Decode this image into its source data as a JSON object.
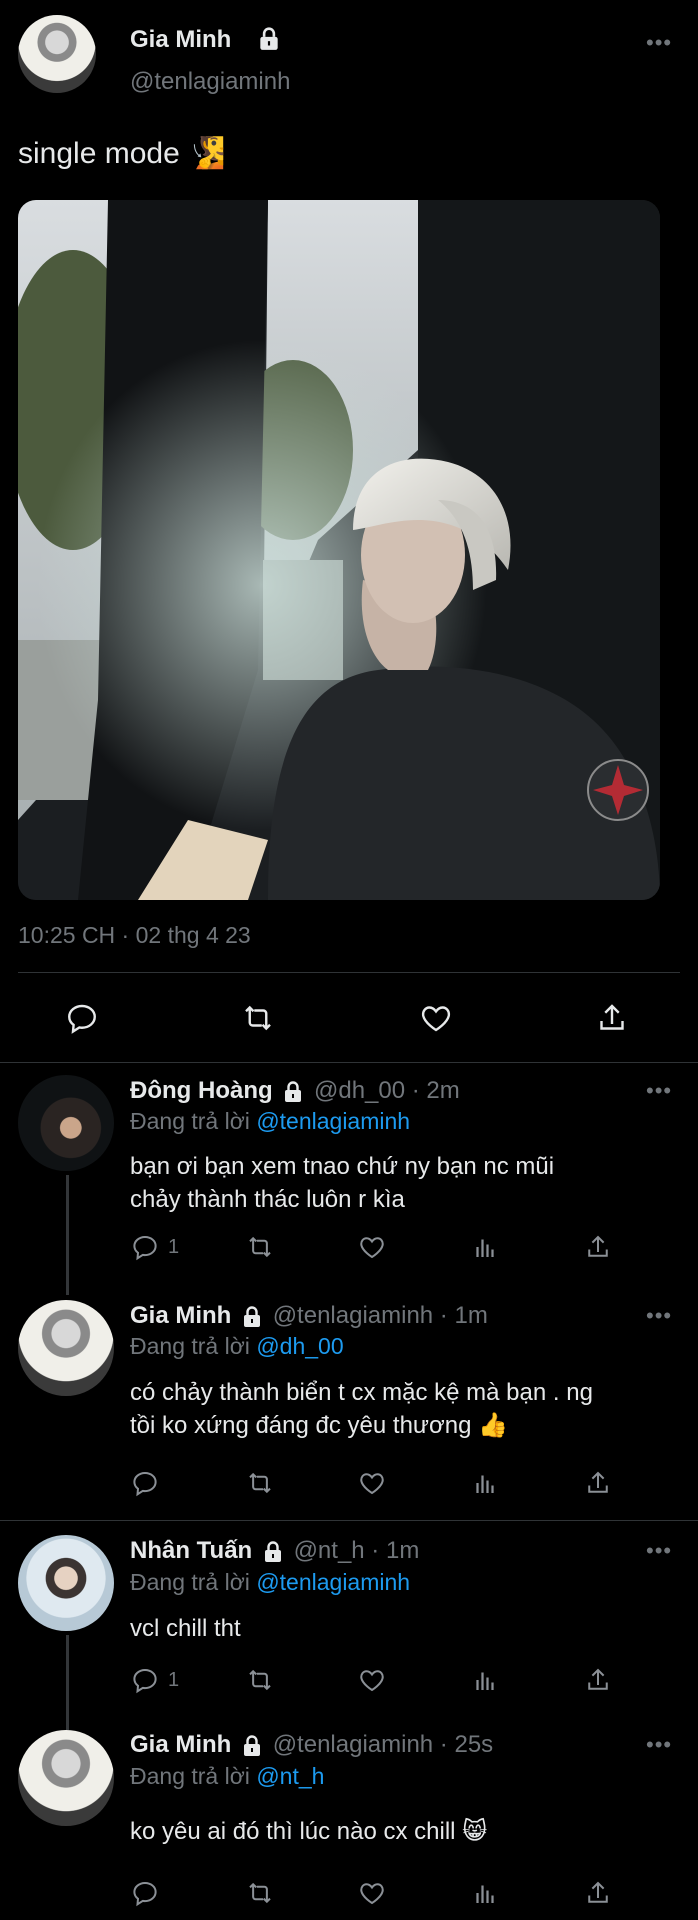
{
  "tweet": {
    "author_name": "Gia Minh",
    "author_handle": "@tenlagiaminh",
    "text": "single mode",
    "emoji": "🧏",
    "time": "10:25 CH · 02 thg 4 23"
  },
  "replies": [
    {
      "name": "Đông Hoàng",
      "meta": "@dh_00 · 2m",
      "replying_prefix": "Đang trả lời",
      "replying_to": "@tenlagiaminh",
      "text_line1": "bạn ơi bạn xem tnao chứ ny bạn nc mũi",
      "text_line2": "chảy thành thác luôn r kìa",
      "reply_count": "1"
    },
    {
      "name": "Gia Minh",
      "meta": "@tenlagiaminh · 1m",
      "replying_prefix": "Đang trả lời",
      "replying_to": "@dh_00",
      "text_line1": "có chảy thành biển t cx mặc kệ mà bạn . ng",
      "text_line2": "tồi ko xứng đáng đc yêu thương 👍",
      "reply_count": ""
    },
    {
      "name": "Nhân Tuấn",
      "meta": "@nt_h · 1m",
      "replying_prefix": "Đang trả lời",
      "replying_to": "@tenlagiaminh",
      "text_line1": "vcl chill tht",
      "text_line2": "",
      "reply_count": "1"
    },
    {
      "name": "Gia Minh",
      "meta": "@tenlagiaminh · 25s",
      "replying_prefix": "Đang trả lời",
      "replying_to": "@nt_h",
      "text_line1": "ko yêu ai đó thì lúc nào cx chill 😸",
      "text_line2": "",
      "reply_count": ""
    }
  ],
  "colors": {
    "background": "#000000",
    "text": "#e7e9ea",
    "muted": "#71767b",
    "link": "#1d9bf0",
    "divider": "#2f3336"
  }
}
